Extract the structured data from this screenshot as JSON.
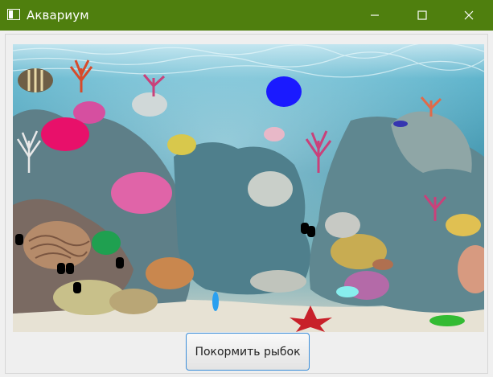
{
  "window": {
    "title": "Аквариум",
    "title_bar_color": "#4f7f0e",
    "controls": {
      "minimize_icon": "minimize-icon",
      "maximize_icon": "maximize-icon",
      "close_icon": "close-icon"
    }
  },
  "aquarium": {
    "background_image": "coral reef underwater scene",
    "fish": [
      {
        "name": "blue-fish",
        "color": "#1a1aff"
      },
      {
        "name": "pink-fish",
        "color": "#e8106a"
      },
      {
        "name": "green-fish",
        "color": "#1fa050"
      },
      {
        "name": "light-pink-fish",
        "color": "#e8b8c8"
      },
      {
        "name": "navy-fish",
        "color": "#3535b0"
      },
      {
        "name": "brown-fish",
        "color": "#b07050"
      },
      {
        "name": "cyan-fish",
        "color": "#88eeee"
      },
      {
        "name": "sky-blue-fish",
        "color": "#2aa0f0"
      },
      {
        "name": "lime-fish",
        "color": "#33bb33"
      }
    ],
    "food_particles_color": "#000000"
  },
  "actions": {
    "feed_button_label": "Покормить рыбок"
  }
}
